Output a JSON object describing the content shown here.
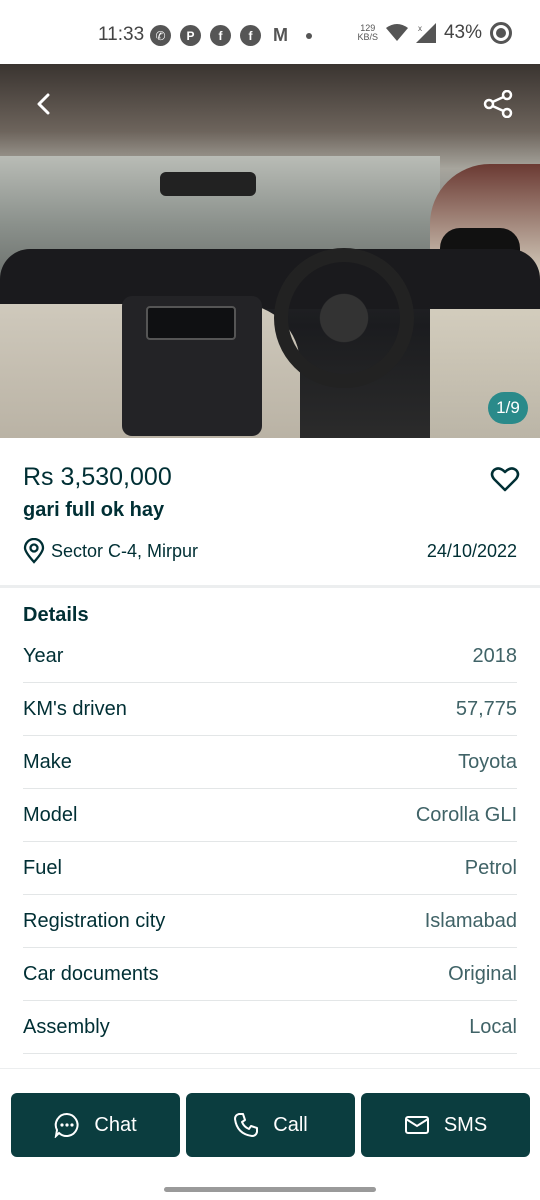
{
  "status_bar": {
    "time": "11:33",
    "notification_icons": [
      "whatsapp-icon",
      "app-icon",
      "facebook-icon",
      "facebook-icon",
      "gmail-icon"
    ],
    "net_speed_value": "129",
    "net_speed_unit": "KB/S",
    "battery": "43%"
  },
  "gallery": {
    "counter": "1/9",
    "icons": {
      "back": "chevron-left-icon",
      "share": "share-icon"
    }
  },
  "listing": {
    "price": "Rs 3,530,000",
    "title": "gari full ok hay",
    "location": "Sector C-4, Mirpur",
    "date": "24/10/2022",
    "favorite_icon": "heart-outline-icon",
    "location_icon": "location-pin-icon"
  },
  "details": {
    "heading": "Details",
    "rows": [
      {
        "label": "Year",
        "value": "2018"
      },
      {
        "label": "KM's driven",
        "value": "57,775"
      },
      {
        "label": "Make",
        "value": "Toyota"
      },
      {
        "label": "Model",
        "value": "Corolla GLI"
      },
      {
        "label": "Fuel",
        "value": "Petrol"
      },
      {
        "label": "Registration city",
        "value": "Islamabad"
      },
      {
        "label": "Car documents",
        "value": "Original"
      },
      {
        "label": "Assembly",
        "value": "Local"
      }
    ]
  },
  "actions": {
    "chat": "Chat",
    "call": "Call",
    "sms": "SMS"
  },
  "colors": {
    "primary": "#002f34",
    "button_bg": "#0b3d3f",
    "counter_bg": "#2a8a8a"
  }
}
